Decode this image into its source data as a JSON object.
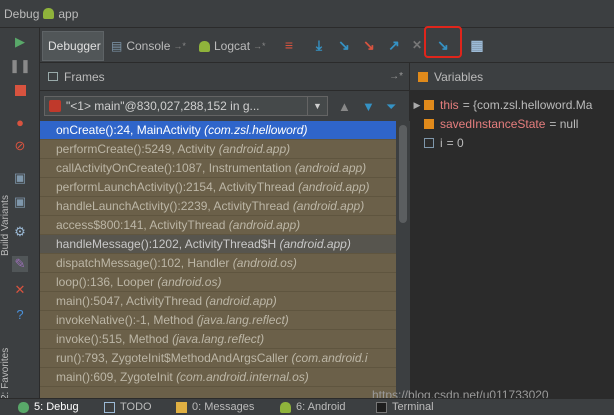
{
  "title": {
    "label": "Debug",
    "app": "app"
  },
  "toolbar": {
    "tabs": [
      {
        "label": "Debugger"
      },
      {
        "label": "Console"
      },
      {
        "label": "Logcat"
      }
    ],
    "buttons": [
      "show-execution-point",
      "step-over",
      "step-into",
      "force-step-into",
      "step-out",
      "drop-frame",
      "run-to-cursor",
      "evaluate-expression"
    ]
  },
  "sidebar": {
    "vertical_labels": [
      "Build Variants",
      "2: Favorites"
    ]
  },
  "frames": {
    "title": "Frames",
    "thread": "\"<1> main\"@830,027,288,152 in g...",
    "rows": [
      {
        "method": "onCreate():24, MainActivity",
        "pkg": "(com.zsl.helloword)"
      },
      {
        "method": "performCreate():5249, Activity",
        "pkg": "(android.app)"
      },
      {
        "method": "callActivityOnCreate():1087, Instrumentation",
        "pkg": "(android.app)"
      },
      {
        "method": "performLaunchActivity():2154, ActivityThread",
        "pkg": "(android.app)"
      },
      {
        "method": "handleLaunchActivity():2239, ActivityThread",
        "pkg": "(android.app)"
      },
      {
        "method": "access$800:141, ActivityThread",
        "pkg": "(android.app)"
      },
      {
        "method": "handleMessage():1202, ActivityThread$H",
        "pkg": "(android.app)"
      },
      {
        "method": "dispatchMessage():102, Handler",
        "pkg": "(android.os)"
      },
      {
        "method": "loop():136, Looper",
        "pkg": "(android.os)"
      },
      {
        "method": "main():5047, ActivityThread",
        "pkg": "(android.app)"
      },
      {
        "method": "invokeNative():-1, Method",
        "pkg": "(java.lang.reflect)"
      },
      {
        "method": "invoke():515, Method",
        "pkg": "(java.lang.reflect)"
      },
      {
        "method": "run():793, ZygoteInit$MethodAndArgsCaller",
        "pkg": "(com.android.i"
      },
      {
        "method": "main():609, ZygoteInit",
        "pkg": "(com.android.internal.os)"
      }
    ]
  },
  "variables": {
    "title": "Variables",
    "rows": [
      {
        "name": "this",
        "value": "= {com.zsl.helloword.Ma"
      },
      {
        "name": "savedInstanceState",
        "value": "= null"
      },
      {
        "name": "i",
        "value": "= 0"
      }
    ]
  },
  "watermark": "https://blog.csdn.net/u011733020",
  "bottom": {
    "tabs": [
      {
        "label": "5: Debug"
      },
      {
        "label": "TODO"
      },
      {
        "label": "0: Messages"
      },
      {
        "label": "6: Android"
      },
      {
        "label": "Terminal"
      }
    ]
  }
}
